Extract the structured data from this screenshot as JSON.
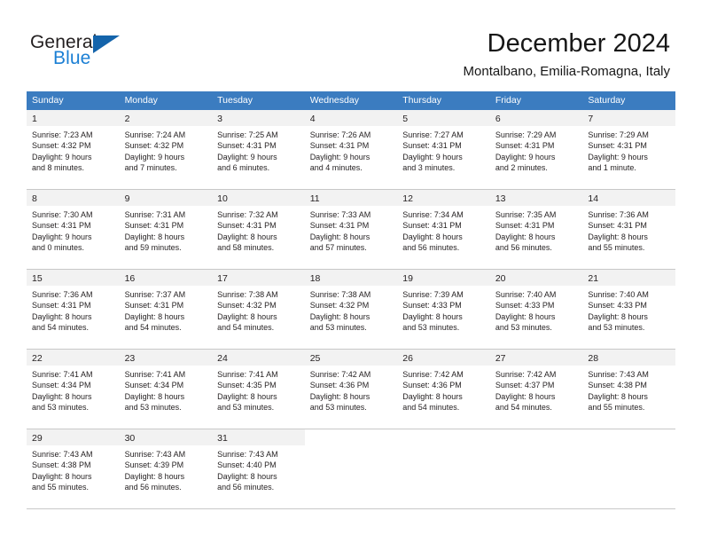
{
  "brand": {
    "name_top": "General",
    "name_bottom": "Blue",
    "accent_color": "#1b7fd4",
    "triangle_color": "#1464ab"
  },
  "header": {
    "title": "December 2024",
    "subtitle": "Montalbano, Emilia-Romagna, Italy"
  },
  "theme": {
    "header_row_bg": "#3b7cc0",
    "header_row_text": "#ffffff",
    "daynum_band_bg": "#f2f2f2",
    "grid_line": "#c8c8c8",
    "text": "#231f20"
  },
  "weekdays": [
    "Sunday",
    "Monday",
    "Tuesday",
    "Wednesday",
    "Thursday",
    "Friday",
    "Saturday"
  ],
  "weeks": [
    [
      {
        "day": "1",
        "sunrise": "Sunrise: 7:23 AM",
        "sunset": "Sunset: 4:32 PM",
        "daylight_line1": "Daylight: 9 hours",
        "daylight_line2": "and 8 minutes."
      },
      {
        "day": "2",
        "sunrise": "Sunrise: 7:24 AM",
        "sunset": "Sunset: 4:32 PM",
        "daylight_line1": "Daylight: 9 hours",
        "daylight_line2": "and 7 minutes."
      },
      {
        "day": "3",
        "sunrise": "Sunrise: 7:25 AM",
        "sunset": "Sunset: 4:31 PM",
        "daylight_line1": "Daylight: 9 hours",
        "daylight_line2": "and 6 minutes."
      },
      {
        "day": "4",
        "sunrise": "Sunrise: 7:26 AM",
        "sunset": "Sunset: 4:31 PM",
        "daylight_line1": "Daylight: 9 hours",
        "daylight_line2": "and 4 minutes."
      },
      {
        "day": "5",
        "sunrise": "Sunrise: 7:27 AM",
        "sunset": "Sunset: 4:31 PM",
        "daylight_line1": "Daylight: 9 hours",
        "daylight_line2": "and 3 minutes."
      },
      {
        "day": "6",
        "sunrise": "Sunrise: 7:29 AM",
        "sunset": "Sunset: 4:31 PM",
        "daylight_line1": "Daylight: 9 hours",
        "daylight_line2": "and 2 minutes."
      },
      {
        "day": "7",
        "sunrise": "Sunrise: 7:29 AM",
        "sunset": "Sunset: 4:31 PM",
        "daylight_line1": "Daylight: 9 hours",
        "daylight_line2": "and 1 minute."
      }
    ],
    [
      {
        "day": "8",
        "sunrise": "Sunrise: 7:30 AM",
        "sunset": "Sunset: 4:31 PM",
        "daylight_line1": "Daylight: 9 hours",
        "daylight_line2": "and 0 minutes."
      },
      {
        "day": "9",
        "sunrise": "Sunrise: 7:31 AM",
        "sunset": "Sunset: 4:31 PM",
        "daylight_line1": "Daylight: 8 hours",
        "daylight_line2": "and 59 minutes."
      },
      {
        "day": "10",
        "sunrise": "Sunrise: 7:32 AM",
        "sunset": "Sunset: 4:31 PM",
        "daylight_line1": "Daylight: 8 hours",
        "daylight_line2": "and 58 minutes."
      },
      {
        "day": "11",
        "sunrise": "Sunrise: 7:33 AM",
        "sunset": "Sunset: 4:31 PM",
        "daylight_line1": "Daylight: 8 hours",
        "daylight_line2": "and 57 minutes."
      },
      {
        "day": "12",
        "sunrise": "Sunrise: 7:34 AM",
        "sunset": "Sunset: 4:31 PM",
        "daylight_line1": "Daylight: 8 hours",
        "daylight_line2": "and 56 minutes."
      },
      {
        "day": "13",
        "sunrise": "Sunrise: 7:35 AM",
        "sunset": "Sunset: 4:31 PM",
        "daylight_line1": "Daylight: 8 hours",
        "daylight_line2": "and 56 minutes."
      },
      {
        "day": "14",
        "sunrise": "Sunrise: 7:36 AM",
        "sunset": "Sunset: 4:31 PM",
        "daylight_line1": "Daylight: 8 hours",
        "daylight_line2": "and 55 minutes."
      }
    ],
    [
      {
        "day": "15",
        "sunrise": "Sunrise: 7:36 AM",
        "sunset": "Sunset: 4:31 PM",
        "daylight_line1": "Daylight: 8 hours",
        "daylight_line2": "and 54 minutes."
      },
      {
        "day": "16",
        "sunrise": "Sunrise: 7:37 AM",
        "sunset": "Sunset: 4:31 PM",
        "daylight_line1": "Daylight: 8 hours",
        "daylight_line2": "and 54 minutes."
      },
      {
        "day": "17",
        "sunrise": "Sunrise: 7:38 AM",
        "sunset": "Sunset: 4:32 PM",
        "daylight_line1": "Daylight: 8 hours",
        "daylight_line2": "and 54 minutes."
      },
      {
        "day": "18",
        "sunrise": "Sunrise: 7:38 AM",
        "sunset": "Sunset: 4:32 PM",
        "daylight_line1": "Daylight: 8 hours",
        "daylight_line2": "and 53 minutes."
      },
      {
        "day": "19",
        "sunrise": "Sunrise: 7:39 AM",
        "sunset": "Sunset: 4:33 PM",
        "daylight_line1": "Daylight: 8 hours",
        "daylight_line2": "and 53 minutes."
      },
      {
        "day": "20",
        "sunrise": "Sunrise: 7:40 AM",
        "sunset": "Sunset: 4:33 PM",
        "daylight_line1": "Daylight: 8 hours",
        "daylight_line2": "and 53 minutes."
      },
      {
        "day": "21",
        "sunrise": "Sunrise: 7:40 AM",
        "sunset": "Sunset: 4:33 PM",
        "daylight_line1": "Daylight: 8 hours",
        "daylight_line2": "and 53 minutes."
      }
    ],
    [
      {
        "day": "22",
        "sunrise": "Sunrise: 7:41 AM",
        "sunset": "Sunset: 4:34 PM",
        "daylight_line1": "Daylight: 8 hours",
        "daylight_line2": "and 53 minutes."
      },
      {
        "day": "23",
        "sunrise": "Sunrise: 7:41 AM",
        "sunset": "Sunset: 4:34 PM",
        "daylight_line1": "Daylight: 8 hours",
        "daylight_line2": "and 53 minutes."
      },
      {
        "day": "24",
        "sunrise": "Sunrise: 7:41 AM",
        "sunset": "Sunset: 4:35 PM",
        "daylight_line1": "Daylight: 8 hours",
        "daylight_line2": "and 53 minutes."
      },
      {
        "day": "25",
        "sunrise": "Sunrise: 7:42 AM",
        "sunset": "Sunset: 4:36 PM",
        "daylight_line1": "Daylight: 8 hours",
        "daylight_line2": "and 53 minutes."
      },
      {
        "day": "26",
        "sunrise": "Sunrise: 7:42 AM",
        "sunset": "Sunset: 4:36 PM",
        "daylight_line1": "Daylight: 8 hours",
        "daylight_line2": "and 54 minutes."
      },
      {
        "day": "27",
        "sunrise": "Sunrise: 7:42 AM",
        "sunset": "Sunset: 4:37 PM",
        "daylight_line1": "Daylight: 8 hours",
        "daylight_line2": "and 54 minutes."
      },
      {
        "day": "28",
        "sunrise": "Sunrise: 7:43 AM",
        "sunset": "Sunset: 4:38 PM",
        "daylight_line1": "Daylight: 8 hours",
        "daylight_line2": "and 55 minutes."
      }
    ],
    [
      {
        "day": "29",
        "sunrise": "Sunrise: 7:43 AM",
        "sunset": "Sunset: 4:38 PM",
        "daylight_line1": "Daylight: 8 hours",
        "daylight_line2": "and 55 minutes."
      },
      {
        "day": "30",
        "sunrise": "Sunrise: 7:43 AM",
        "sunset": "Sunset: 4:39 PM",
        "daylight_line1": "Daylight: 8 hours",
        "daylight_line2": "and 56 minutes."
      },
      {
        "day": "31",
        "sunrise": "Sunrise: 7:43 AM",
        "sunset": "Sunset: 4:40 PM",
        "daylight_line1": "Daylight: 8 hours",
        "daylight_line2": "and 56 minutes."
      },
      {
        "day": "",
        "sunrise": "",
        "sunset": "",
        "daylight_line1": "",
        "daylight_line2": ""
      },
      {
        "day": "",
        "sunrise": "",
        "sunset": "",
        "daylight_line1": "",
        "daylight_line2": ""
      },
      {
        "day": "",
        "sunrise": "",
        "sunset": "",
        "daylight_line1": "",
        "daylight_line2": ""
      },
      {
        "day": "",
        "sunrise": "",
        "sunset": "",
        "daylight_line1": "",
        "daylight_line2": ""
      }
    ]
  ]
}
